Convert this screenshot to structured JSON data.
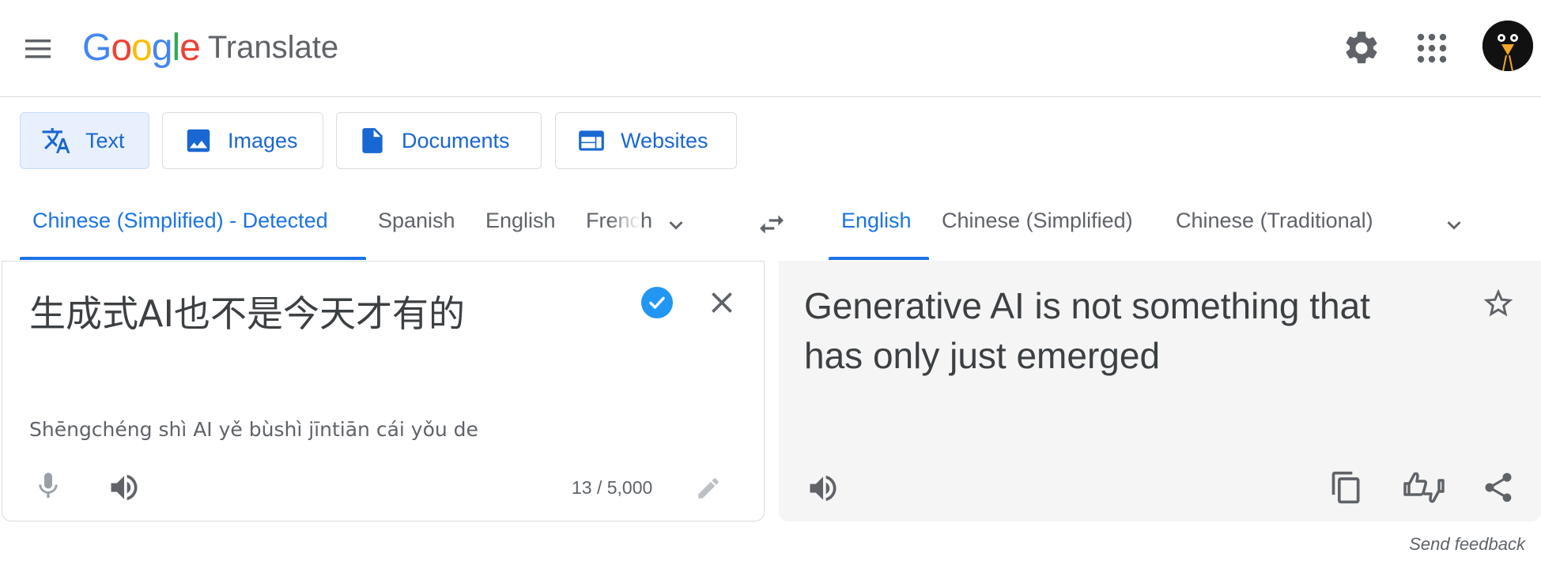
{
  "header": {
    "logo_letters": [
      "G",
      "o",
      "o",
      "g",
      "l",
      "e"
    ],
    "logo_colors": [
      "#4285f4",
      "#ea4335",
      "#fbbc05",
      "#4285f4",
      "#34a853",
      "#ea4335"
    ],
    "product_name": "Translate",
    "icons": [
      "menu-icon",
      "gear-icon",
      "apps-grid-icon",
      "avatar"
    ]
  },
  "mode_tabs": [
    {
      "label": "Text",
      "icon": "translate-icon",
      "active": true
    },
    {
      "label": "Images",
      "icon": "image-icon",
      "active": false
    },
    {
      "label": "Documents",
      "icon": "document-icon",
      "active": false
    },
    {
      "label": "Websites",
      "icon": "website-icon",
      "active": false
    }
  ],
  "source_languages": {
    "items": [
      "Chinese (Simplified) - Detected",
      "Spanish",
      "English",
      "French"
    ],
    "active_index": 0
  },
  "target_languages": {
    "items": [
      "English",
      "Chinese (Simplified)",
      "Chinese (Traditional)"
    ],
    "active_index": 0
  },
  "source": {
    "text": "生成式AI也不是今天才有的",
    "romanization": "Shēngchéng shì AI yě bùshì jīntiān cái yǒu de",
    "char_count": "13 / 5,000"
  },
  "target": {
    "text": "Generative AI is not something that has only just emerged"
  },
  "footer": {
    "feedback": "Send feedback"
  },
  "colors": {
    "accent": "#1a73e8",
    "active_tab_bg": "#e8f0fe",
    "target_panel_bg": "#f5f5f5",
    "check_blue": "#2196f3"
  }
}
